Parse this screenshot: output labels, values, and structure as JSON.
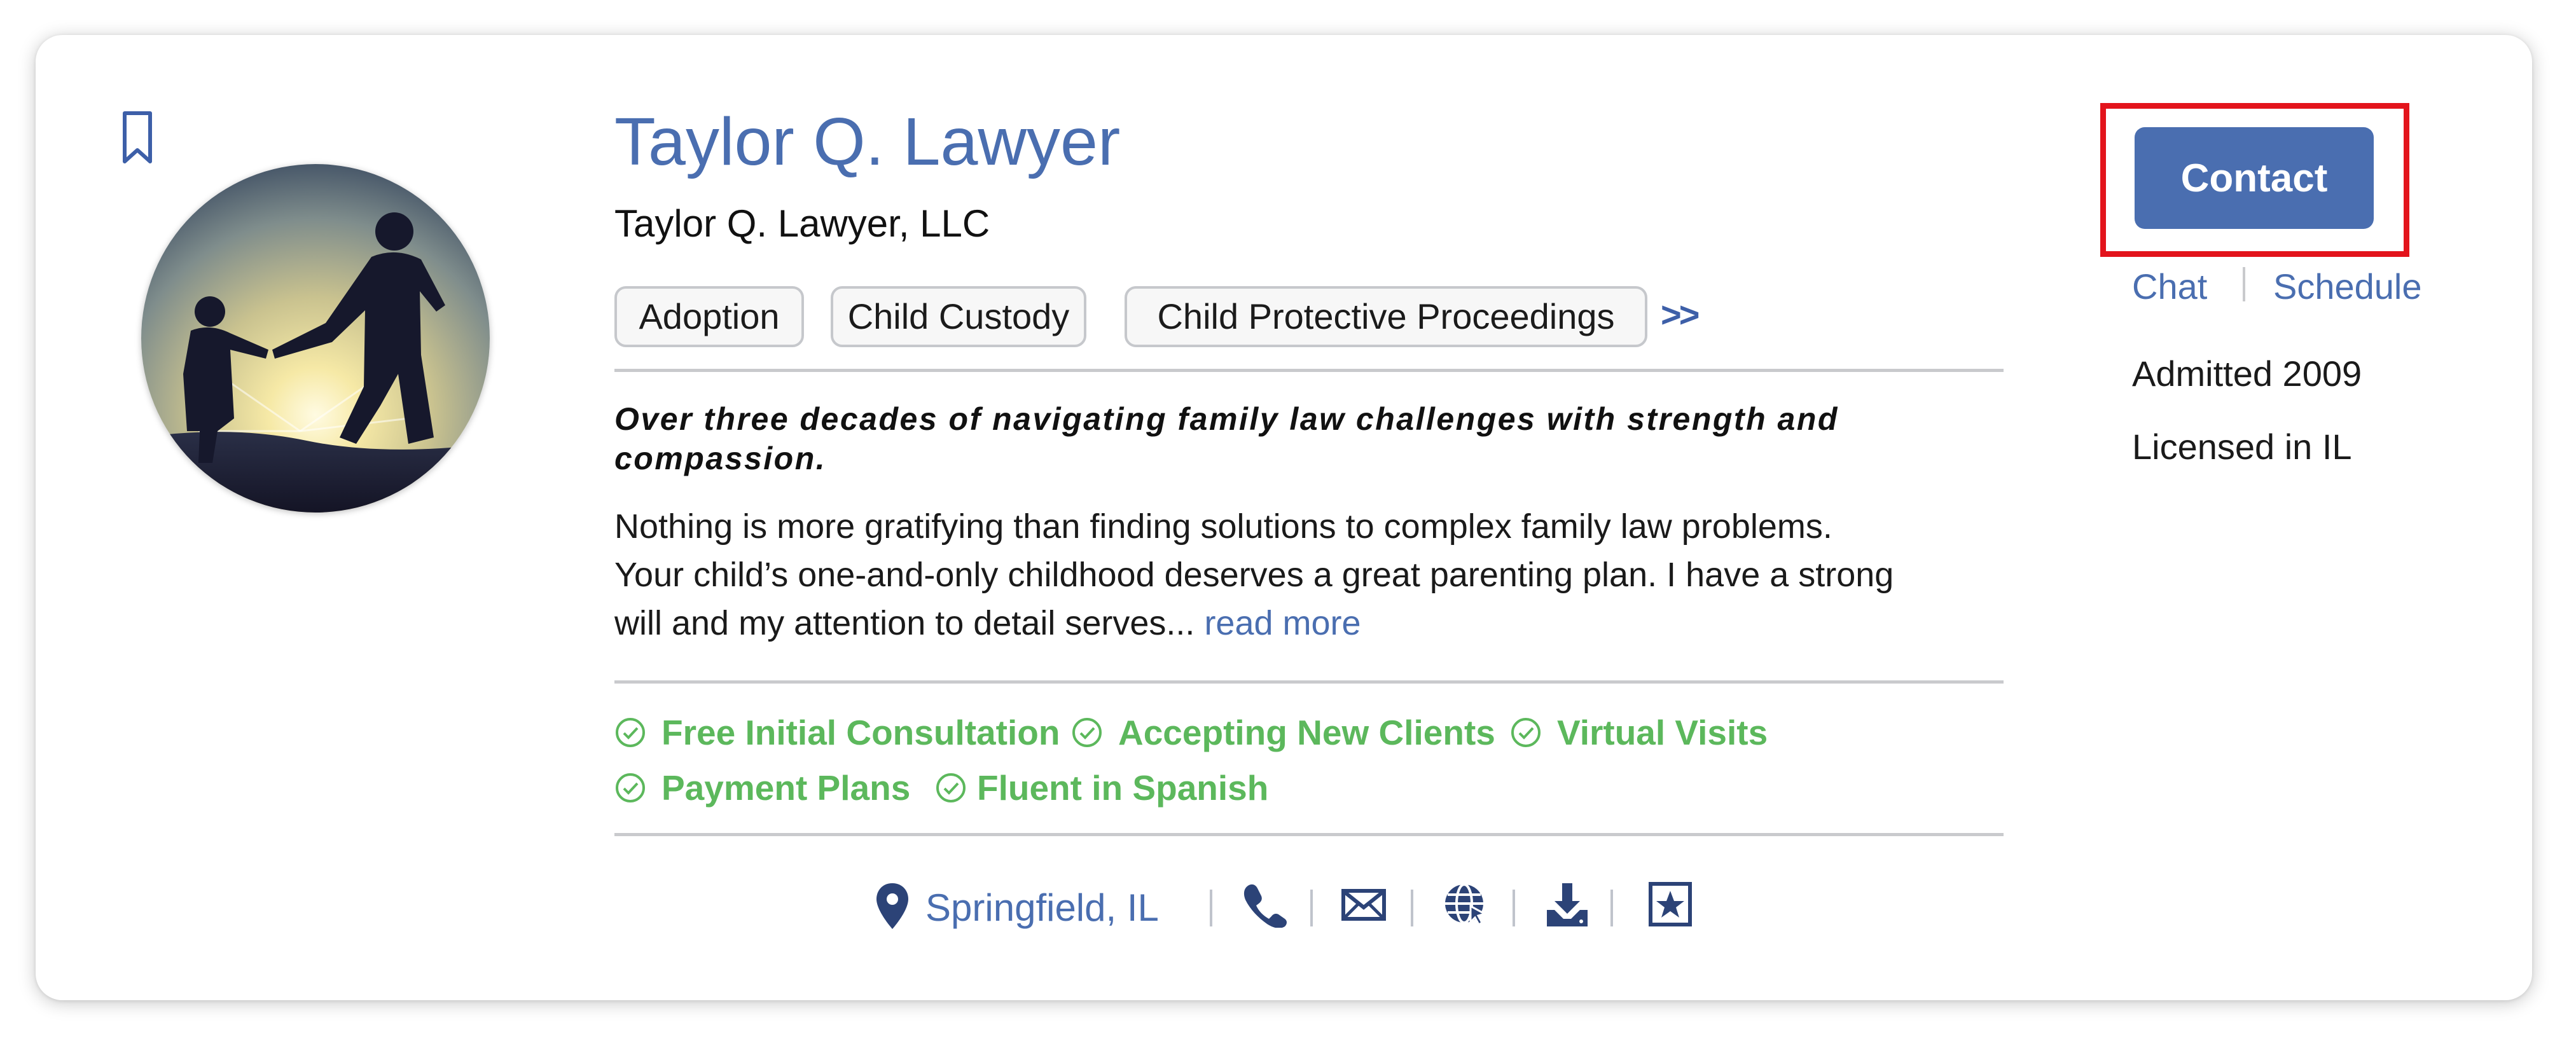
{
  "profile": {
    "name": "Taylor Q. Lawyer",
    "firm": "Taylor Q. Lawyer, LLC",
    "tags": [
      "Adoption",
      "Child Custody",
      "Child Protective Proceedings"
    ],
    "tags_more": ">>",
    "tagline": "Over three decades of navigating family law challenges with strength and compassion.",
    "bio": "Nothing is more gratifying than finding solutions to complex family law problems. Your child’s one-and-only childhood deserves a great parenting plan. I have a strong will and my attention to detail serves... ",
    "read_more": "read more",
    "features": [
      "Free Initial Consultation",
      "Accepting New Clients",
      "Virtual Visits",
      "Payment Plans",
      "Fluent in Spanish"
    ],
    "location": "Springfield, IL",
    "icons": [
      "location-pin-icon",
      "phone-icon",
      "email-icon",
      "website-icon",
      "download-icon",
      "badge-star-icon",
      "bookmark-icon",
      "check-circle-icon"
    ]
  },
  "sidebar": {
    "contact_label": "Contact",
    "chat_label": "Chat",
    "schedule_label": "Schedule",
    "admitted": "Admitted 2009",
    "licensed": "Licensed in IL"
  },
  "colors": {
    "brand_blue": "#4a6eb0",
    "icon_navy": "#2c4377",
    "feature_green": "#5cb85c",
    "highlight_red": "#e3141c"
  }
}
